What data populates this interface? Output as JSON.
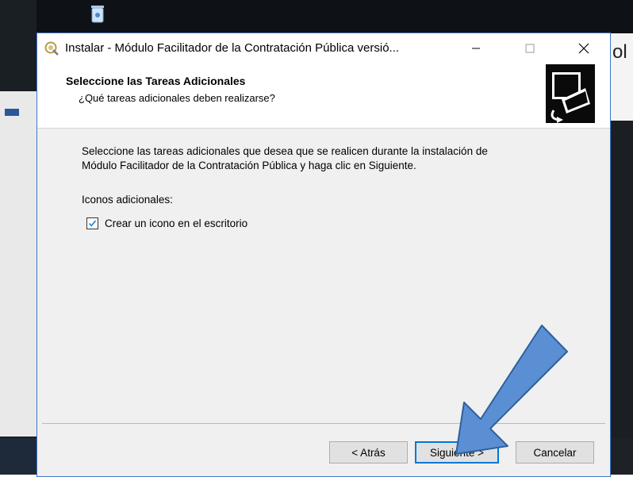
{
  "dialog": {
    "title": "Instalar - Módulo Facilitador de la Contratación Pública versió...",
    "header_title": "Seleccione las Tareas Adicionales",
    "header_subtitle": "¿Qué tareas adicionales deben realizarse?",
    "body_line1": "Seleccione las tareas adicionales que desea que se realicen durante la instalación de",
    "body_line2": "Módulo Facilitador de la Contratación Pública y haga clic en Siguiente.",
    "section_label": "Iconos adicionales:",
    "checkbox_label": "Crear un icono en el escritorio",
    "checkbox_checked": true
  },
  "buttons": {
    "back": "< Atrás",
    "next": "Siguiente >",
    "cancel": "Cancelar"
  },
  "window_controls": {
    "minimize": "—",
    "maximize": "☐",
    "close": "✕"
  },
  "background": {
    "partial_text": "ol"
  },
  "colors": {
    "accent": "#0078d7",
    "arrow_fill": "#5b8fd4",
    "arrow_stroke": "#2f5f9e"
  }
}
